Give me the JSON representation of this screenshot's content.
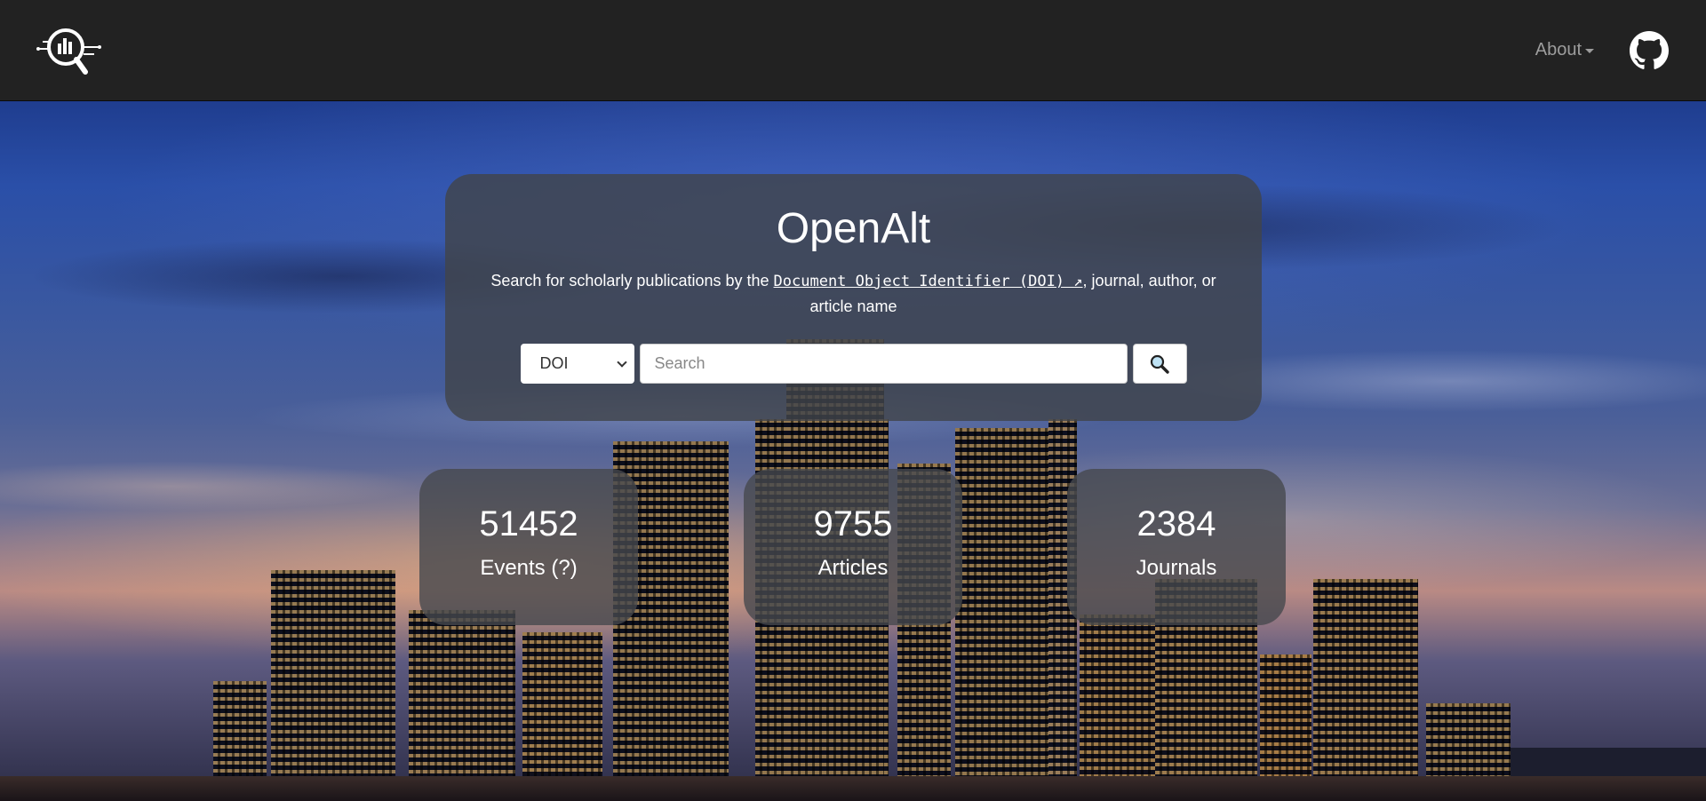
{
  "nav": {
    "about_label": "About"
  },
  "hero": {
    "title": "OpenAlt",
    "subtitle_prefix": "Search for scholarly publications by the ",
    "doi_link_text": "Document Object Identifier (DOI) ↗",
    "subtitle_suffix": ", journal, author, or article name",
    "search_type_selected": "DOI",
    "search_placeholder": "Search"
  },
  "stats": [
    {
      "value": "51452",
      "label": "Events (?)"
    },
    {
      "value": "9755",
      "label": "Articles"
    },
    {
      "value": "2384",
      "label": "Journals"
    }
  ],
  "icons": {
    "logo": "magnifier-chart-logo",
    "github": "github-icon",
    "search": "magnifying-glass-icon"
  }
}
